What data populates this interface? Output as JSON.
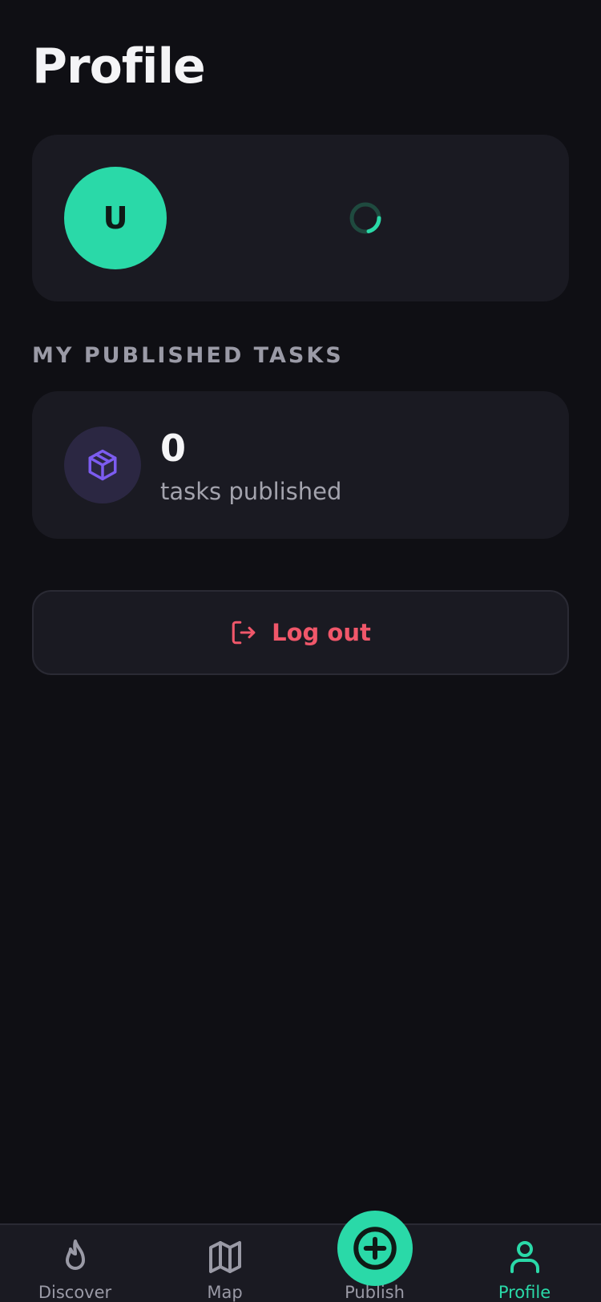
{
  "page": {
    "title": "Profile"
  },
  "profile": {
    "avatar_initial": "U",
    "loading_icon": "spinner-icon"
  },
  "published_tasks": {
    "heading": "MY PUBLISHED TASKS",
    "count": "0",
    "label": "tasks published",
    "icon": "package-icon"
  },
  "logout": {
    "label": "Log out",
    "icon": "logout-icon"
  },
  "nav": {
    "items": [
      {
        "label": "Discover",
        "icon": "flame-icon",
        "active": false
      },
      {
        "label": "Map",
        "icon": "map-icon",
        "active": false
      },
      {
        "label": "Publish",
        "icon": "plus-circle-icon",
        "active": false
      },
      {
        "label": "Profile",
        "icon": "user-icon",
        "active": true
      }
    ]
  },
  "colors": {
    "background": "#0f0f14",
    "card": "#1a1a22",
    "accent": "#2ad9a8",
    "danger": "#f0576a",
    "muted_text": "#9a9aa6",
    "purple_icon": "#7c5cf0"
  }
}
